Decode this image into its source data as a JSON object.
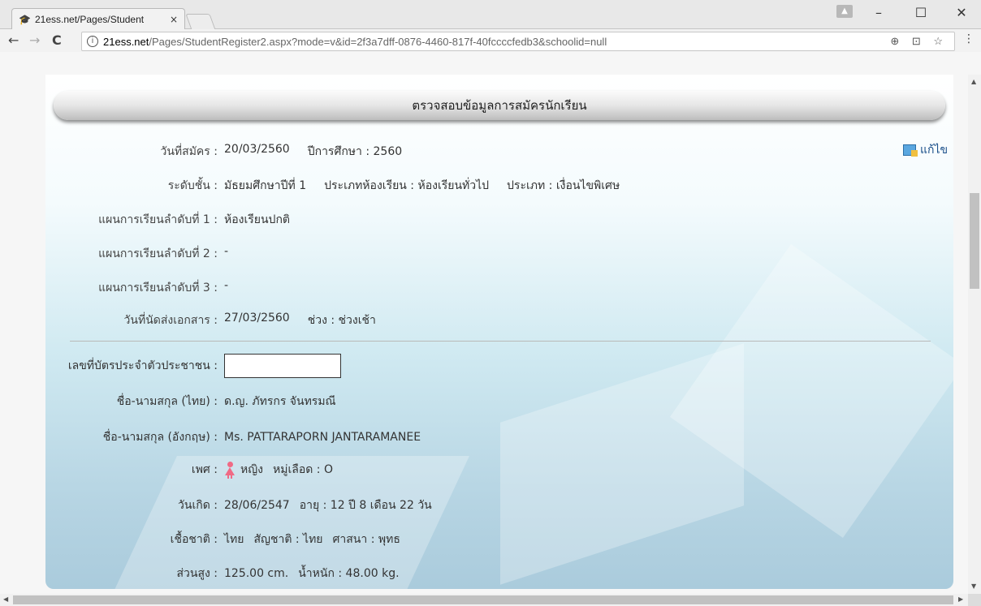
{
  "browser": {
    "tab_title": "21ess.net/Pages/Student",
    "tab_close": "×",
    "url_host": "21ess.net",
    "url_path": "/Pages/StudentRegister2.aspx?mode=v&id=2f3a7dff-0876-4460-817f-40fccccfedb3&schoolid=null",
    "back": "←",
    "forward": "→",
    "reload": "C",
    "info": "i",
    "minimize": "–",
    "maximize": "☐",
    "close": "✕",
    "menu": "⋮",
    "omni_icons": "⊕ ⊡ ☆"
  },
  "page": {
    "header_title": "ตรวจสอบข้อมูลการสมัครนักเรียน",
    "edit_label": "แก้ไข"
  },
  "application": {
    "date_label": "วันที่สมัคร :",
    "date_value": "20/03/2560",
    "year_text": "ปีการศึกษา : 2560",
    "level_label": "ระดับชั้น :",
    "level_value": "มัธยมศึกษาปีที่ 1",
    "room_type_text": "ประเภทห้องเรียน : ห้องเรียนทั่วไป",
    "type_text": "ประเภท : เงื่อนไขพิเศษ",
    "plan1_label": "แผนการเรียนลำดับที่ 1 :",
    "plan1_value": "ห้องเรียนปกติ",
    "plan2_label": "แผนการเรียนลำดับที่ 2 :",
    "plan2_value": "-",
    "plan3_label": "แผนการเรียนลำดับที่ 3 :",
    "plan3_value": "-",
    "docs_label": "วันที่นัดส่งเอกสาร :",
    "docs_value": "27/03/2560",
    "period_text": "ช่วง : ช่วงเช้า"
  },
  "student": {
    "id_label": "เลขที่บัตรประจำตัวประชาชน :",
    "name_th_label": "ชื่อ-นามสกุล (ไทย) :",
    "name_th_value": "ด.ญ. ภัทรกร จันทรมณี",
    "name_en_label": "ชื่อ-นามสกุล (อังกฤษ) :",
    "name_en_value": "Ms. PATTARAPORN JANTARAMANEE",
    "sex_label": "เพศ :",
    "sex_value": "หญิง",
    "blood_text": "หมู่เลือด : O",
    "birth_label": "วันเกิด :",
    "birth_value": "28/06/2547",
    "age_text": "อายุ : 12 ปี 8 เดือน 22 วัน",
    "race_label": "เชื้อชาติ :",
    "race_value": "ไทย",
    "nationality_text": "สัญชาติ : ไทย",
    "religion_text": "ศาสนา : พุทธ",
    "height_label": "ส่วนสูง :",
    "height_value": "125.00 cm.",
    "weight_text": "น้ำหนัก : 48.00 kg."
  }
}
